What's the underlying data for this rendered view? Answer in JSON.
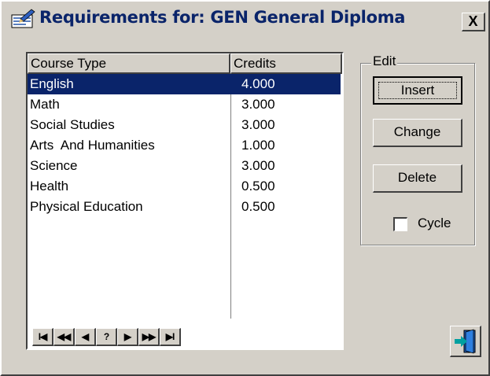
{
  "window": {
    "title": "Requirements for: GEN General Diploma",
    "close_label": "X"
  },
  "list": {
    "columns": [
      "Course Type",
      "Credits"
    ],
    "rows": [
      {
        "course_type": "English",
        "credits": "4.000",
        "selected": true
      },
      {
        "course_type": "Math",
        "credits": "3.000",
        "selected": false
      },
      {
        "course_type": "Social Studies",
        "credits": "3.000",
        "selected": false
      },
      {
        "course_type": "Arts  And Humanities",
        "credits": "1.000",
        "selected": false
      },
      {
        "course_type": "Science",
        "credits": "3.000",
        "selected": false
      },
      {
        "course_type": "Health",
        "credits": "0.500",
        "selected": false
      },
      {
        "course_type": "Physical Education",
        "credits": "0.500",
        "selected": false
      }
    ]
  },
  "navigator": {
    "buttons": [
      "I◀",
      "◀◀",
      "◀",
      "?",
      "▶",
      "▶▶",
      "▶I"
    ]
  },
  "edit_group": {
    "label": "Edit",
    "insert_label": "Insert",
    "change_label": "Change",
    "delete_label": "Delete",
    "cycle_label": "Cycle",
    "cycle_checked": false
  },
  "icons": {
    "title_icon": "clipboard-pen-icon",
    "exit_icon": "exit-door-icon"
  },
  "colors": {
    "selection": "#0a246a",
    "title_text": "#0a246a",
    "face": "#d4d0c8"
  }
}
